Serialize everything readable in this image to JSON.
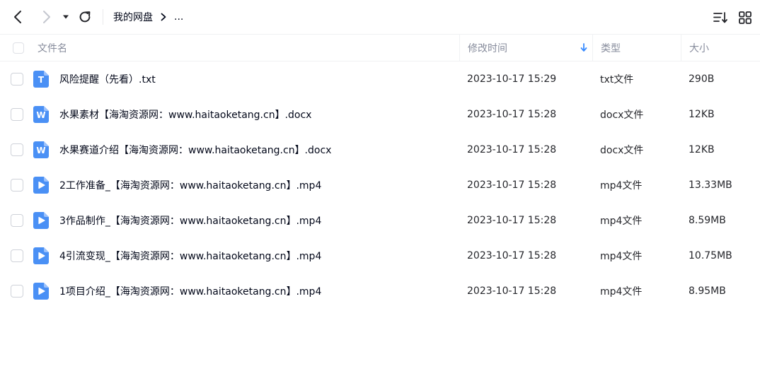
{
  "toolbar": {
    "breadcrumb_root": "我的网盘",
    "breadcrumb_more": "..."
  },
  "colors": {
    "accent": "#3a8cff",
    "icon_bg": "#4a90f5",
    "header_text": "#878c9c",
    "text": "#03081a"
  },
  "table": {
    "headers": {
      "name": "文件名",
      "modified": "修改时间",
      "type": "类型",
      "size": "大小"
    },
    "sort_indicator": "down-arrow-icon",
    "rows": [
      {
        "icon": "txt-file-icon",
        "icon_letter": "T",
        "name": "风险提醒（先看）.txt",
        "modified": "2023-10-17 15:29",
        "type": "txt文件",
        "size": "290B"
      },
      {
        "icon": "word-file-icon",
        "icon_letter": "W",
        "name": "水果素材【海淘资源网：www.haitaoketang.cn】.docx",
        "modified": "2023-10-17 15:28",
        "type": "docx文件",
        "size": "12KB"
      },
      {
        "icon": "word-file-icon",
        "icon_letter": "W",
        "name": "水果赛道介绍【海淘资源网：www.haitaoketang.cn】.docx",
        "modified": "2023-10-17 15:28",
        "type": "docx文件",
        "size": "12KB"
      },
      {
        "icon": "video-file-icon",
        "icon_letter": "",
        "name": "2工作准备_【海淘资源网：www.haitaoketang.cn】.mp4",
        "modified": "2023-10-17 15:28",
        "type": "mp4文件",
        "size": "13.33MB"
      },
      {
        "icon": "video-file-icon",
        "icon_letter": "",
        "name": "3作品制作_【海淘资源网：www.haitaoketang.cn】.mp4",
        "modified": "2023-10-17 15:28",
        "type": "mp4文件",
        "size": "8.59MB"
      },
      {
        "icon": "video-file-icon",
        "icon_letter": "",
        "name": "4引流变现_【海淘资源网：www.haitaoketang.cn】.mp4",
        "modified": "2023-10-17 15:28",
        "type": "mp4文件",
        "size": "10.75MB"
      },
      {
        "icon": "video-file-icon",
        "icon_letter": "",
        "name": "1项目介绍_【海淘资源网：www.haitaoketang.cn】.mp4",
        "modified": "2023-10-17 15:28",
        "type": "mp4文件",
        "size": "8.95MB"
      }
    ]
  }
}
